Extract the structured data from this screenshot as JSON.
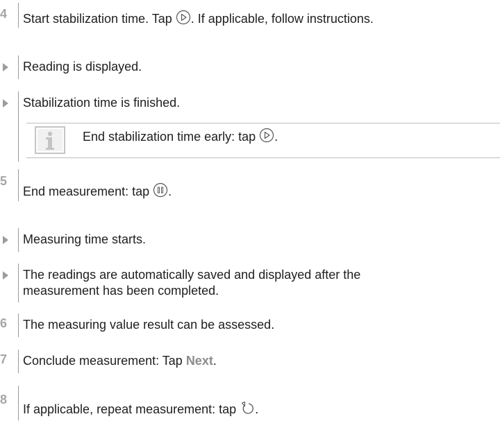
{
  "steps": [
    {
      "marker": "4",
      "text": "Start stabilization time. Tap ",
      "suffix": ". If applicable, follow instructions.",
      "icon": "play-circle-icon"
    },
    {
      "marker": "",
      "text": "Reading is displayed."
    },
    {
      "marker": "",
      "text": "Stabilization time is finished."
    },
    {
      "marker": "5",
      "text": "End measurement: tap ",
      "suffix": ".",
      "icon": "pause-circle-icon"
    },
    {
      "marker": "",
      "text": "Measuring time starts."
    },
    {
      "marker": "",
      "text_line1": "The readings are automatically saved and displayed after the",
      "text_line2": "measurement has been completed."
    },
    {
      "marker": "6",
      "text": "The measuring value result can be assessed."
    },
    {
      "marker": "7",
      "text": "Conclude measurement: Tap ",
      "emphasis": "Next",
      "suffix": "."
    },
    {
      "marker": "8",
      "text": "If applicable, repeat measurement: tap ",
      "suffix": ".",
      "icon": "repeat-arrow-icon"
    }
  ],
  "note": {
    "text": "End stabilization time early: tap ",
    "suffix": ".",
    "icon": "info-icon",
    "action_icon": "play-circle-icon"
  },
  "colors": {
    "step_number": "#a6a6a6",
    "result_marker": "#9c9c9c",
    "text": "#1e1e1e",
    "emphasis": "#8c8c8c"
  }
}
